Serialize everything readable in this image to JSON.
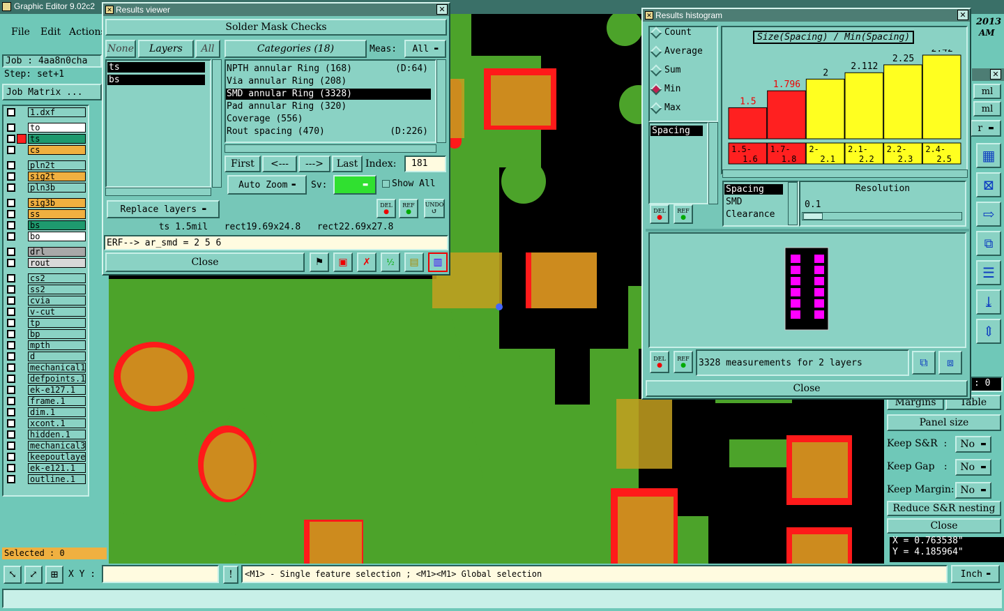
{
  "app": {
    "title": "Graphic Editor 9.02c2"
  },
  "menu": {
    "file": "File",
    "edit": "Edit",
    "actions": "Actions"
  },
  "job": {
    "job_label": "Job : 4aa8n0cha",
    "step_label": "Step: set+1",
    "matrix_btn": "Job Matrix ..."
  },
  "layers": [
    {
      "name": "1.dxf",
      "color": "#8ad2c4"
    },
    {
      "name": "to",
      "color": "#ffffff"
    },
    {
      "name": "ts",
      "color": "#1e9a6e",
      "active": true
    },
    {
      "name": "cs",
      "color": "#f0b040"
    },
    {
      "name": "pln2t",
      "color": "#8ad2c4"
    },
    {
      "name": "sig2t",
      "color": "#f0b040"
    },
    {
      "name": "pln3b",
      "color": "#8ad2c4"
    },
    {
      "name": "sig3b",
      "color": "#f0b040"
    },
    {
      "name": "ss",
      "color": "#f0b040"
    },
    {
      "name": "bs",
      "color": "#1e9a6e"
    },
    {
      "name": "bo",
      "color": "#ffffff"
    },
    {
      "name": "drl",
      "color": "#a8a8a8"
    },
    {
      "name": "rout",
      "color": "#d8d8d8"
    },
    {
      "name": "cs2",
      "color": "#8ad2c4"
    },
    {
      "name": "ss2",
      "color": "#8ad2c4"
    },
    {
      "name": "cvia",
      "color": "#8ad2c4"
    },
    {
      "name": "v-cut",
      "color": "#8ad2c4"
    },
    {
      "name": "tp",
      "color": "#8ad2c4"
    },
    {
      "name": "bp",
      "color": "#8ad2c4"
    },
    {
      "name": "mpth",
      "color": "#8ad2c4"
    },
    {
      "name": "d",
      "color": "#8ad2c4"
    },
    {
      "name": "mechanical1",
      "color": "#8ad2c4"
    },
    {
      "name": "defpoints.1",
      "color": "#8ad2c4"
    },
    {
      "name": "ek-e127.1",
      "color": "#8ad2c4"
    },
    {
      "name": "frame.1",
      "color": "#8ad2c4"
    },
    {
      "name": "dim.1",
      "color": "#8ad2c4"
    },
    {
      "name": "xcont.1",
      "color": "#8ad2c4"
    },
    {
      "name": "hidden.1",
      "color": "#8ad2c4"
    },
    {
      "name": "mechanical3",
      "color": "#8ad2c4"
    },
    {
      "name": "keepoutlayer",
      "color": "#8ad2c4"
    },
    {
      "name": "ek-e121.1",
      "color": "#8ad2c4"
    },
    {
      "name": "outline.1",
      "color": "#8ad2c4"
    }
  ],
  "selected": "Selected : 0",
  "bottom": {
    "xy_label": "X Y :",
    "hint": "<M1> - Single feature selection ; <M1><M1> Global selection",
    "unit": "Inch"
  },
  "results_viewer": {
    "title": "Results viewer",
    "header": "Solder Mask Checks",
    "none_btn": "None",
    "layers_btn": "Layers",
    "all_btn": "All",
    "layers": [
      "ts",
      "bs"
    ],
    "categories_btn": "Categories (18)",
    "meas_label": "Meas:",
    "meas_value": "All",
    "categories": [
      {
        "text": "NPTH annular Ring (168)",
        "extra": "(D:64)"
      },
      {
        "text": "Via annular Ring (208)",
        "extra": ""
      },
      {
        "text": "SMD annular Ring (3328)",
        "extra": "",
        "selected": true
      },
      {
        "text": "Pad annular Ring (320)",
        "extra": ""
      },
      {
        "text": "Coverage (556)",
        "extra": ""
      },
      {
        "text": "Rout spacing (470)",
        "extra": "(D:226)"
      }
    ],
    "first": "First",
    "prev": "<---",
    "next": "--->",
    "last": "Last",
    "index_label": "Index:",
    "index_value": "181",
    "auto_zoom": "Auto Zoom",
    "sv_label": "Sv:",
    "show_all": "Show All",
    "replace_layers": "Replace layers",
    "del": "DEL",
    "ref": "REF",
    "undo": "UNDO",
    "info": "ts 1.5mil   rect19.69x24.8   rect22.69x27.8",
    "erf": "ERF--> ar_smd = 2 5 6",
    "close": "Close"
  },
  "histogram": {
    "title": "Results histogram",
    "options": [
      "Count",
      "Average",
      "Sum",
      "Min",
      "Max"
    ],
    "selected_option": "Min",
    "chart_title": "Size(Spacing) / Min(Spacing)",
    "left_list": [
      "Spacing"
    ],
    "list2": [
      "Spacing",
      "SMD",
      "Clearance"
    ],
    "resolution_label": "Resolution",
    "resolution_value": "0.1",
    "summary": "3328 measurements for 2 layers",
    "del": "DEL",
    "ref": "REF",
    "close": "Close"
  },
  "chart_data": {
    "type": "bar",
    "title": "Size(Spacing) / Min(Spacing)",
    "categories": [
      "1.5-\n1.6",
      "1.7-\n1.8",
      "2-\n2.1",
      "2.1-\n2.2",
      "2.2-\n2.3",
      "2.4-\n2.5"
    ],
    "values": [
      1.5,
      1.796,
      2,
      2.112,
      2.25,
      2.42
    ],
    "labels": [
      "1.5",
      "1.796",
      "2",
      "2.112",
      "2.25",
      "2.42"
    ],
    "colors": [
      "#ff2020",
      "#ff2020",
      "#ffff20",
      "#ffff20",
      "#ffff20",
      "#ffff20"
    ],
    "ylim": [
      0,
      2.42
    ]
  },
  "right_panel": {
    "year": "2013",
    "ampm": "AM",
    "ml1": "ml",
    "ml2": "ml",
    "r": "r",
    "zero": ": 0",
    "margins": "Margins",
    "table": "Table",
    "panel_size": "Panel size",
    "keep_sr": "Keep S&R  :",
    "keep_gap": "Keep Gap   :",
    "keep_margin": "Keep Margin:",
    "no": "No",
    "reduce": "Reduce S&R nesting",
    "close": "Close",
    "x_coord": "X = 0.763538\"",
    "y_coord": "Y = 4.185964\""
  }
}
